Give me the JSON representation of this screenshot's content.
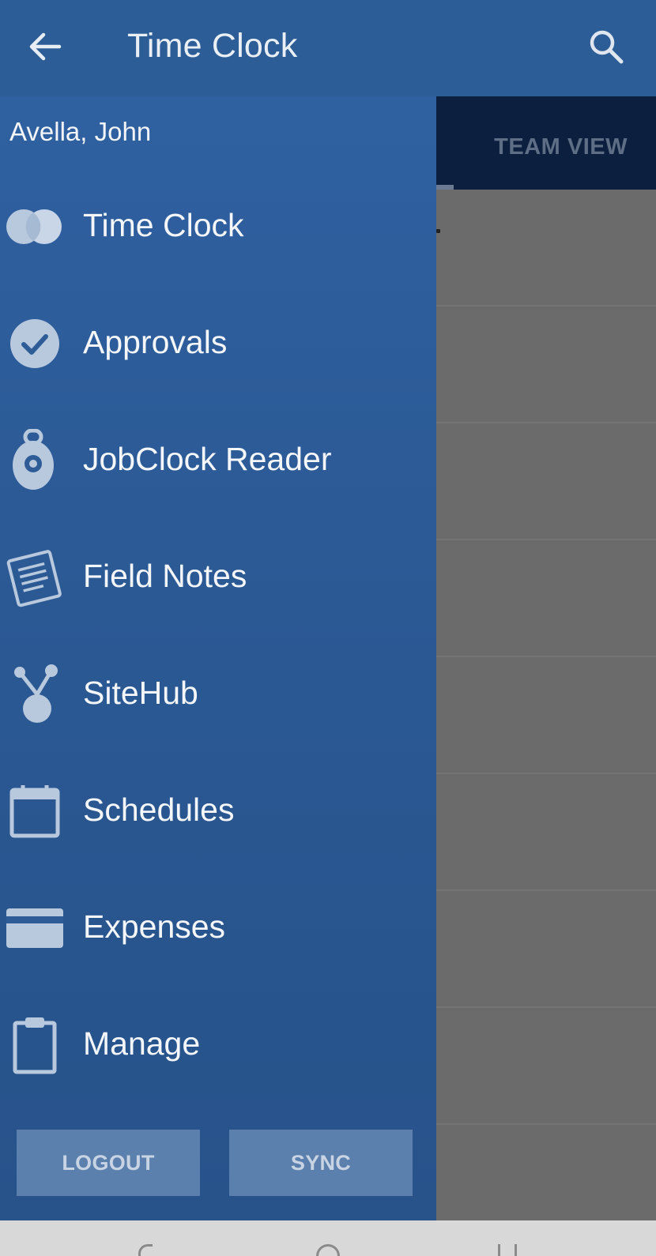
{
  "appbar": {
    "title": "Time Clock",
    "back_icon": "arrow-left-icon",
    "search_icon": "search-icon"
  },
  "background": {
    "tab_label": "TEAM VIEW"
  },
  "drawer": {
    "user_name": "Avella, John",
    "items": [
      {
        "label": "Time Clock",
        "icon": "time-clock-icon"
      },
      {
        "label": "Approvals",
        "icon": "check-circle-icon"
      },
      {
        "label": "JobClock Reader",
        "icon": "jobclock-icon"
      },
      {
        "label": "Field Notes",
        "icon": "notes-icon"
      },
      {
        "label": "SiteHub",
        "icon": "sitehub-icon"
      },
      {
        "label": "Schedules",
        "icon": "calendar-icon"
      },
      {
        "label": "Expenses",
        "icon": "credit-card-icon"
      },
      {
        "label": "Manage",
        "icon": "clipboard-icon"
      }
    ],
    "logout_label": "LOGOUT",
    "sync_label": "SYNC"
  },
  "colors": {
    "appbar": "#2c5d96",
    "drawer": "#2b5994",
    "icon_fill": "#b7c7dc",
    "overlay": "#6b6b6b"
  }
}
